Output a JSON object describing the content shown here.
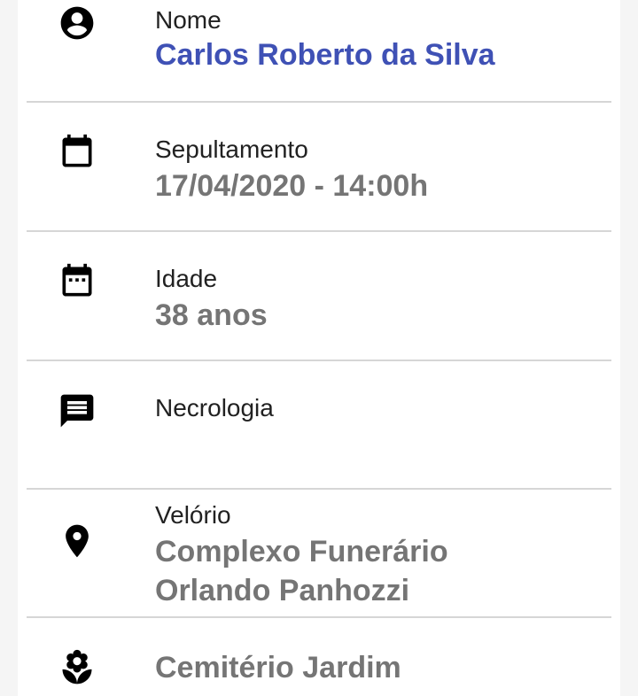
{
  "colors": {
    "accent": "#3f51b5",
    "value": "#757575",
    "label": "#212121",
    "icon": "#000000",
    "divider": "#d6d6d6"
  },
  "rows": [
    {
      "icon": "account-circle-icon",
      "label": "Nome",
      "value": "Carlos Roberto da Silva"
    },
    {
      "icon": "calendar-icon",
      "label": "Sepultamento",
      "value": "17/04/2020 - 14:00h"
    },
    {
      "icon": "calendar-today-icon",
      "label": "Idade",
      "value": "38 anos"
    },
    {
      "icon": "message-icon",
      "label": "Necrologia",
      "value": ""
    },
    {
      "icon": "location-pin-icon",
      "label": "Velório",
      "value_line1": "Complexo Funerário",
      "value_line2": "Orlando Panhozzi"
    },
    {
      "icon": "flower-icon",
      "label": "",
      "value": "Cemitério Jardim"
    }
  ]
}
